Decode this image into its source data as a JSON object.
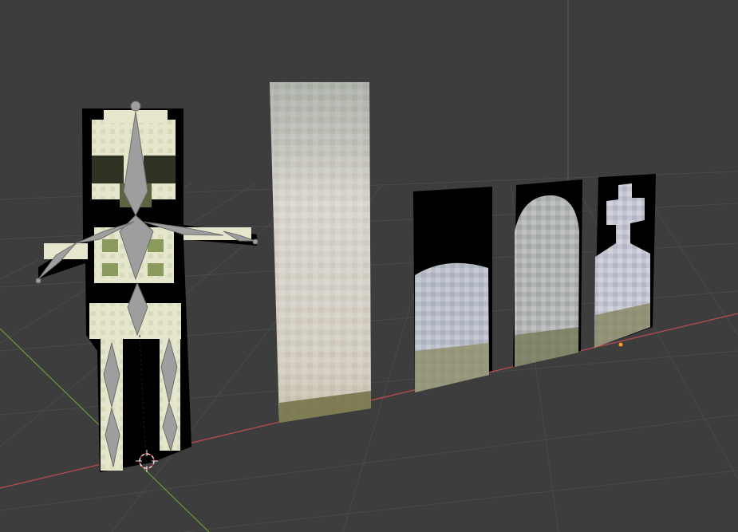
{
  "viewport": {
    "background": "#3d3d3d",
    "grid_color": "#4a4a4a",
    "x_axis_color": "#b34a52",
    "y_axis_color": "#6a9a3a",
    "z_axis_color": "#5a5a5a",
    "armature_color": "#9e9e9e",
    "cursor_color": "#e8e8e8",
    "cursor_accent": "#d0343a",
    "origin_color": "#ff9a1e"
  },
  "objects": [
    {
      "name": "skeleton-sprite",
      "colors": {
        "bone": "#e6e6cc",
        "shade": "#a5ad7a",
        "dark": "#5b6340",
        "bg": "#000000"
      }
    },
    {
      "name": "tall-stone-sprite",
      "colors": {
        "top": "#9aa49a",
        "mid": "#dad6d0",
        "bottom": "#bfb6a4",
        "moss": "#6b6a3c"
      }
    },
    {
      "name": "rounded-tombstone-sprite",
      "colors": {
        "stone": "#b8bcc6",
        "moss": "#88875a",
        "bg": "#000000"
      }
    },
    {
      "name": "arched-tombstone-sprite",
      "colors": {
        "stone": "#b4b6b8",
        "moss": "#6e7048",
        "bg": "#000000"
      }
    },
    {
      "name": "cross-tombstone-sprite",
      "colors": {
        "stone": "#c4c6d2",
        "moss": "#7d7a50",
        "bg": "#000000"
      }
    }
  ]
}
